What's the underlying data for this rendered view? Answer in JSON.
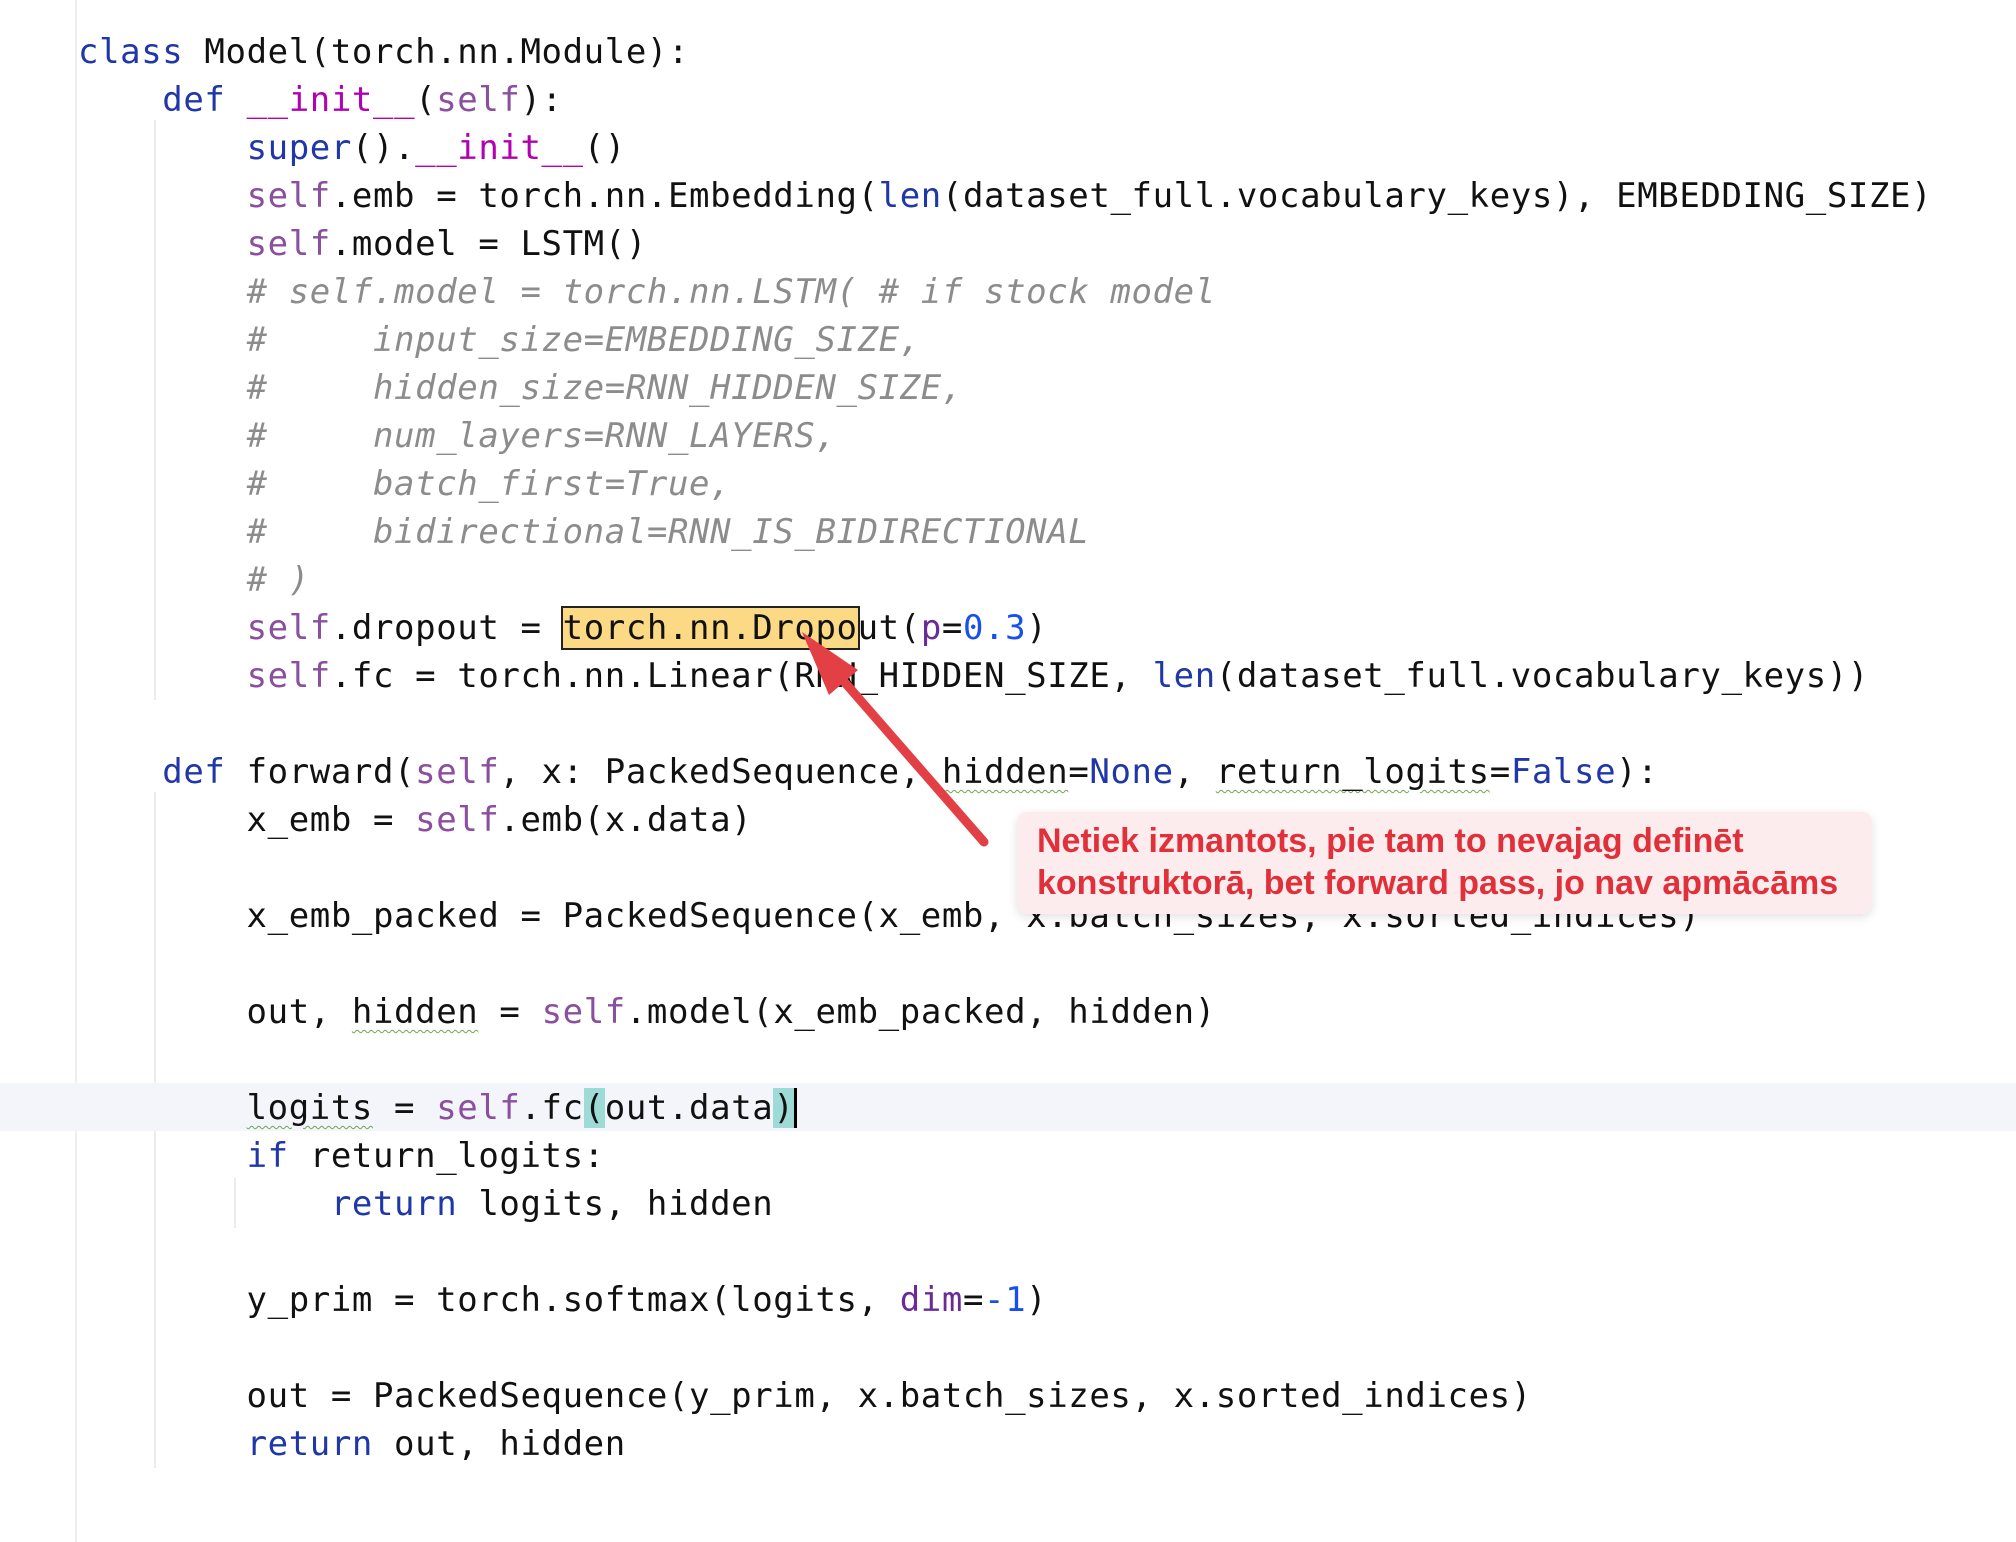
{
  "editor": {
    "language": "python",
    "lines": [
      [
        {
          "t": "class",
          "c": "kw"
        },
        {
          "t": " Model(torch.nn.Module):"
        }
      ],
      [
        {
          "t": "    "
        },
        {
          "t": "def",
          "c": "kw"
        },
        {
          "t": " "
        },
        {
          "t": "__init__",
          "c": "magic"
        },
        {
          "t": "("
        },
        {
          "t": "self",
          "c": "self"
        },
        {
          "t": "):"
        }
      ],
      [
        {
          "t": "        "
        },
        {
          "t": "super",
          "c": "kw"
        },
        {
          "t": "()."
        },
        {
          "t": "__init__",
          "c": "magic"
        },
        {
          "t": "()"
        }
      ],
      [
        {
          "t": "        "
        },
        {
          "t": "self",
          "c": "self"
        },
        {
          "t": ".emb = torch.nn.Embedding("
        },
        {
          "t": "len",
          "c": "kw"
        },
        {
          "t": "(dataset_full.vocabulary_keys), EMBEDDING_SIZE)"
        }
      ],
      [
        {
          "t": "        "
        },
        {
          "t": "self",
          "c": "self"
        },
        {
          "t": ".model = LSTM()"
        }
      ],
      [
        {
          "t": "        "
        },
        {
          "t": "# self.model = torch.nn.LSTM( # if stock model",
          "c": "cm"
        }
      ],
      [
        {
          "t": "        "
        },
        {
          "t": "#     input_size=EMBEDDING_SIZE,",
          "c": "cm"
        }
      ],
      [
        {
          "t": "        "
        },
        {
          "t": "#     hidden_size=RNN_HIDDEN_SIZE,",
          "c": "cm"
        }
      ],
      [
        {
          "t": "        "
        },
        {
          "t": "#     num_layers=RNN_LAYERS,",
          "c": "cm"
        }
      ],
      [
        {
          "t": "        "
        },
        {
          "t": "#     batch_first=True,",
          "c": "cm"
        }
      ],
      [
        {
          "t": "        "
        },
        {
          "t": "#     bidirectional=RNN_IS_BIDIRECTIONAL",
          "c": "cm"
        }
      ],
      [
        {
          "t": "        "
        },
        {
          "t": "# )",
          "c": "cm"
        }
      ],
      [
        {
          "t": "        "
        },
        {
          "t": "self",
          "c": "self"
        },
        {
          "t": ".dropout = "
        },
        {
          "t": "torch.nn.Dropo",
          "c": "hl"
        },
        {
          "t": "ut("
        },
        {
          "t": "p",
          "c": "param"
        },
        {
          "t": "="
        },
        {
          "t": "0.3",
          "c": "num"
        },
        {
          "t": ")"
        }
      ],
      [
        {
          "t": "        "
        },
        {
          "t": "self",
          "c": "self"
        },
        {
          "t": ".fc = torch.nn.Linear(RNN_HIDDEN_SIZE, "
        },
        {
          "t": "len",
          "c": "kw"
        },
        {
          "t": "(dataset_full.vocabulary_keys))"
        }
      ],
      [],
      [
        {
          "t": "    "
        },
        {
          "t": "def",
          "c": "kw"
        },
        {
          "t": " forward("
        },
        {
          "t": "self",
          "c": "self"
        },
        {
          "t": ", x: PackedSequence, "
        },
        {
          "t": "hidden",
          "c": "squig"
        },
        {
          "t": "="
        },
        {
          "t": "None",
          "c": "kw"
        },
        {
          "t": ", "
        },
        {
          "t": "return_logits",
          "c": "squig"
        },
        {
          "t": "="
        },
        {
          "t": "False",
          "c": "kw"
        },
        {
          "t": "):"
        }
      ],
      [
        {
          "t": "        x_emb = "
        },
        {
          "t": "self",
          "c": "self"
        },
        {
          "t": ".emb(x.data)"
        }
      ],
      [],
      [
        {
          "t": "        x_emb_packed = PackedSequence(x_emb, x.batch_sizes, x.sorted_indices)"
        }
      ],
      [],
      [
        {
          "t": "        out, "
        },
        {
          "t": "hidden",
          "c": "squig"
        },
        {
          "t": " = "
        },
        {
          "t": "self",
          "c": "self"
        },
        {
          "t": ".model(x_emb_packed, hidden)"
        }
      ],
      [],
      [
        {
          "t": "        "
        },
        {
          "t": "logits",
          "c": "squig"
        },
        {
          "t": " = "
        },
        {
          "t": "self",
          "c": "self"
        },
        {
          "t": ".fc"
        },
        {
          "t": "(",
          "c": "brace"
        },
        {
          "t": "out.data"
        },
        {
          "t": ")",
          "c": "brace caret"
        }
      ],
      [
        {
          "t": "        "
        },
        {
          "t": "if",
          "c": "kw"
        },
        {
          "t": " return_logits:"
        }
      ],
      [
        {
          "t": "            "
        },
        {
          "t": "return",
          "c": "kw"
        },
        {
          "t": " logits, hidden"
        }
      ],
      [],
      [
        {
          "t": "        y_prim = torch.softmax(logits, "
        },
        {
          "t": "dim",
          "c": "param"
        },
        {
          "t": "="
        },
        {
          "t": "-1",
          "c": "num"
        },
        {
          "t": ")"
        }
      ],
      [],
      [
        {
          "t": "        out = PackedSequence(y_prim, x.batch_sizes, x.sorted_indices)"
        }
      ],
      [
        {
          "t": "        "
        },
        {
          "t": "return",
          "c": "kw"
        },
        {
          "t": " out, hidden"
        }
      ]
    ]
  },
  "annotation": {
    "line1": "Netiek izmantots, pie tam to nevajag definēt",
    "line2": "konstruktorā, bet forward pass, jo nav apmācāms",
    "color": "#e0303a"
  }
}
